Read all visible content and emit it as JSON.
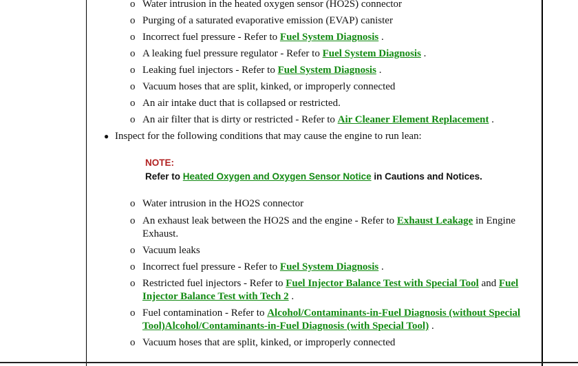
{
  "list1": [
    {
      "text": "Water intrusion in the heated oxygen sensor (HO2S) connector"
    },
    {
      "text": "Purging of a saturated evaporative emission (EVAP) canister"
    },
    {
      "pre": "Incorrect fuel pressure - Refer to ",
      "link": "Fuel System Diagnosis",
      "post": " ."
    },
    {
      "pre": "A leaking fuel pressure regulator - Refer to ",
      "link": "Fuel System Diagnosis",
      "post": " ."
    },
    {
      "pre": "Leaking fuel injectors - Refer to ",
      "link": "Fuel System Diagnosis",
      "post": " ."
    },
    {
      "text": "Vacuum hoses that are split, kinked, or improperly connected"
    },
    {
      "text": "An air intake duct that is collapsed or restricted."
    },
    {
      "pre": "An air filter that is dirty or restricted - Refer to ",
      "link": "Air Cleaner Element Replacement",
      "post": " ."
    }
  ],
  "inspect": "Inspect for the following conditions that may cause the engine to run lean:",
  "note": {
    "heading": "NOTE:",
    "pre": "Refer to ",
    "link": "Heated Oxygen and Oxygen Sensor Notice",
    "post": " in Cautions and Notices."
  },
  "list2": [
    {
      "text": "Water intrusion in the HO2S connector"
    },
    {
      "pre": "An exhaust leak between the HO2S and the engine - Refer to ",
      "link": "Exhaust Leakage",
      "post": " in Engine Exhaust."
    },
    {
      "text": "Vacuum leaks"
    },
    {
      "pre": "Incorrect fuel pressure - Refer to ",
      "link": "Fuel System Diagnosis",
      "post": " ."
    },
    {
      "pre": "Restricted fuel injectors - Refer to ",
      "link": "Fuel Injector Balance Test with Special Tool",
      "mid": " and ",
      "link2": "Fuel Injector Balance Test with Tech 2",
      "post": " ."
    },
    {
      "pre": "Fuel contamination - Refer to ",
      "link": "Alcohol/Contaminants-in-Fuel Diagnosis (without Special Tool)",
      "link2": "Alcohol/Contaminants-in-Fuel Diagnosis (with Special Tool)",
      "post": " ."
    },
    {
      "text": "Vacuum hoses that are split, kinked, or improperly connected"
    }
  ],
  "bullet_symbols": {
    "sub": "o",
    "top": "●"
  },
  "colors": {
    "link": "#138a13",
    "note_heading": "#b22222"
  }
}
